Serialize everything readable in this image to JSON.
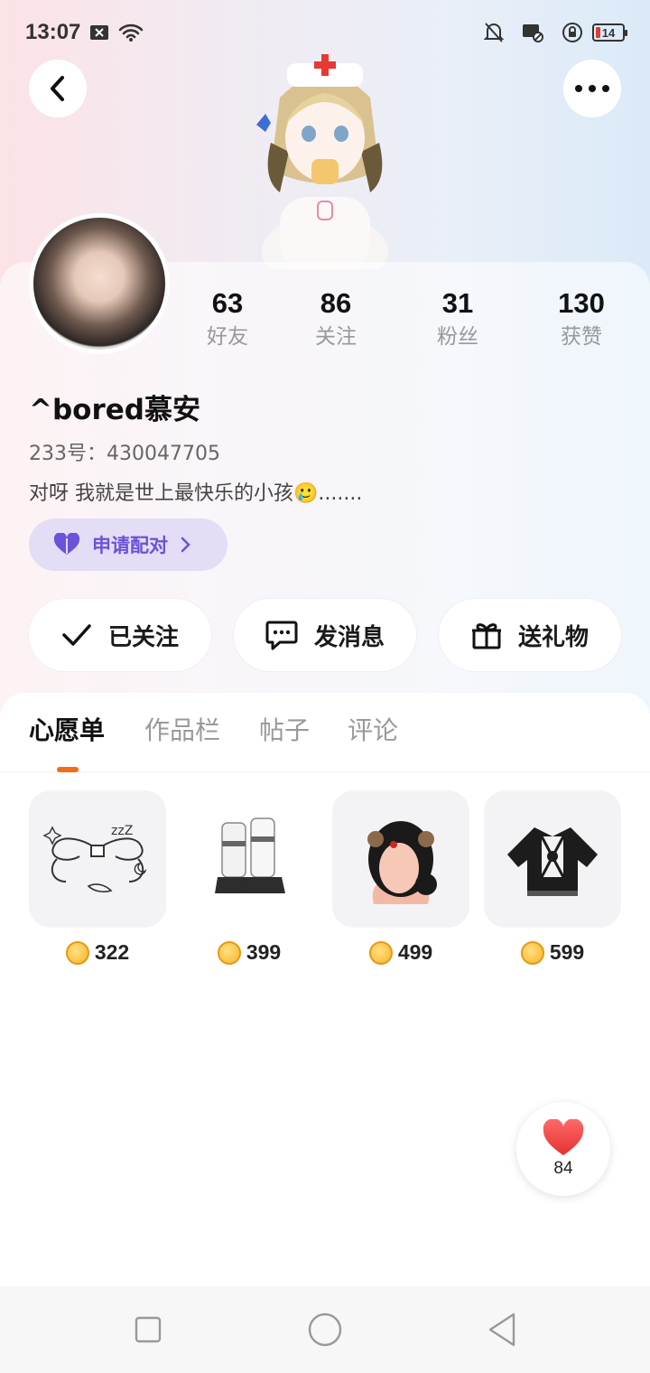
{
  "status_bar": {
    "time": "13:07",
    "battery": "14"
  },
  "profile": {
    "name": "^bored慕安",
    "uid": "233号：430047705",
    "bio": "对呀 我就是世上最快乐的小孩🥲.......",
    "pair_label": "申请配对"
  },
  "stats": [
    {
      "value": "63",
      "label": "好友"
    },
    {
      "value": "86",
      "label": "关注"
    },
    {
      "value": "31",
      "label": "粉丝"
    },
    {
      "value": "130",
      "label": "获赞"
    }
  ],
  "actions": {
    "follow": "已关注",
    "message": "发消息",
    "gift": "送礼物"
  },
  "tabs": [
    "心愿单",
    "作品栏",
    "帖子",
    "评论"
  ],
  "wishlist": [
    {
      "icon": "bow-accessory-icon",
      "price": "322"
    },
    {
      "icon": "white-boots-icon",
      "price": "399"
    },
    {
      "icon": "black-hair-bun-icon",
      "price": "499"
    },
    {
      "icon": "black-jacket-icon",
      "price": "599"
    }
  ],
  "like": {
    "count": "84"
  },
  "colors": {
    "accent": "#f06e17",
    "pair": "#6a52d9",
    "heart": "#ef3b3b"
  }
}
